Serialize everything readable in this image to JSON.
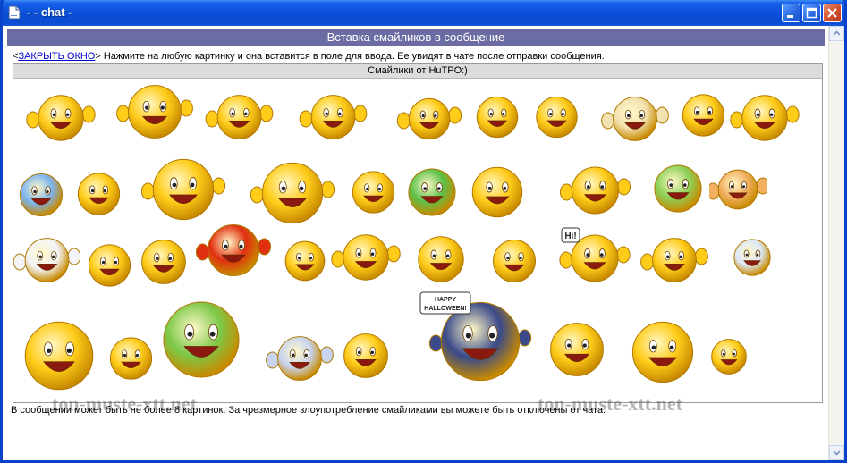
{
  "window": {
    "title": "- - chat -",
    "colors": {
      "titlebar": "#0a4fd8",
      "header_bar": "#6c6ca4",
      "link": "#0000cc"
    }
  },
  "page": {
    "header": "Вставка смайликов в сообщение",
    "close_link": "ЗАКРЫТЬ ОКНО",
    "instructions": "Нажмите на любую картинку и она вставится в поле для ввода. Ее увидят в чате после отправки сообщения.",
    "smiles_caption": "Смайлики от HuTPO:)",
    "footer_note": "В сообщении может быть не более 8 картинок. За чрезмерное злоупотребление смайликами вы можете быть отключены от чата."
  },
  "watermarks": [
    "ton-muste-xtt.net",
    "ton-muste-xtt.net"
  ],
  "badge_texts": {
    "hi": "Hi!",
    "halloween_1": "HAPPY",
    "halloween_2": "HALLOWEEN!"
  },
  "smileys": [
    {
      "name": "waving-kiss-smiley"
    },
    {
      "name": "thumbs-up-smiley"
    },
    {
      "name": "grin-hands-smiley"
    },
    {
      "name": "laughing-wave-smiley"
    },
    {
      "name": "wink-pointing-smiley"
    },
    {
      "name": "crying-smiley"
    },
    {
      "name": "heart-eyes-smiley"
    },
    {
      "name": "bandaged-mummy-smiley"
    },
    {
      "name": "screaming-smiley"
    },
    {
      "name": "surprised-hand-smiley"
    },
    {
      "name": "blue-cold-smiley"
    },
    {
      "name": "big-laugh-smiley"
    },
    {
      "name": "bat-smiley"
    },
    {
      "name": "angel-smiley"
    },
    {
      "name": "smiling-smiley"
    },
    {
      "name": "green-sick-smiley"
    },
    {
      "name": "facepalm-smiley"
    },
    {
      "name": "spider-smiley"
    },
    {
      "name": "frankenstein-smiley"
    },
    {
      "name": "burger-smiley"
    },
    {
      "name": "ghost-smiley"
    },
    {
      "name": "content-smiley"
    },
    {
      "name": "thinking-smiley"
    },
    {
      "name": "red-devil-smiley"
    },
    {
      "name": "blushing-smiley"
    },
    {
      "name": "laughing-open-arms-smiley"
    },
    {
      "name": "crazy-eye-smiley"
    },
    {
      "name": "bow-smiley"
    },
    {
      "name": "hi-smiley"
    },
    {
      "name": "wave-smiley"
    },
    {
      "name": "blob-smiley"
    },
    {
      "name": "hearts-kiss-smiley"
    },
    {
      "name": "sad-tears-smiley"
    },
    {
      "name": "witch-smiley"
    },
    {
      "name": "vampire-smiley"
    },
    {
      "name": "grinning-smiley"
    },
    {
      "name": "grim-reaper-smiley"
    },
    {
      "name": "pointing-smiley"
    },
    {
      "name": "beer-smiley"
    },
    {
      "name": "dancing-smiley"
    }
  ]
}
